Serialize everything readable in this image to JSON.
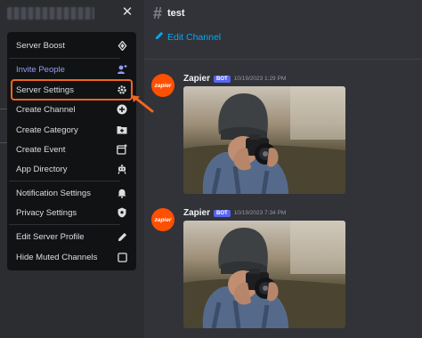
{
  "window": {
    "close_icon": "close-icon",
    "server_name_redacted": true
  },
  "channel": {
    "name": "test",
    "hash_icon": "hash-icon",
    "edit_label": "Edit Channel",
    "edit_icon": "pencil-icon"
  },
  "menu": {
    "items": [
      {
        "label": "Server Boost",
        "icon": "boost-icon"
      },
      {
        "label": "Invite People",
        "icon": "add-user-icon",
        "accent": true
      },
      {
        "label": "Server Settings",
        "icon": "gear-icon",
        "highlighted": true
      },
      {
        "label": "Create Channel",
        "icon": "plus-circle-icon"
      },
      {
        "label": "Create Category",
        "icon": "folder-plus-icon"
      },
      {
        "label": "Create Event",
        "icon": "calendar-plus-icon"
      },
      {
        "label": "App Directory",
        "icon": "robot-icon"
      },
      {
        "label": "Notification Settings",
        "icon": "bell-icon"
      },
      {
        "label": "Privacy Settings",
        "icon": "shield-icon"
      },
      {
        "label": "Edit Server Profile",
        "icon": "pencil-icon"
      },
      {
        "label": "Hide Muted Channels",
        "icon": "checkbox-icon"
      }
    ]
  },
  "messages": [
    {
      "author": "Zapier",
      "badge": "BOT",
      "timestamp": "10/19/2023 1:29 PM",
      "avatar_text": "zapier",
      "attachment": "photo-of-person-with-camera"
    },
    {
      "author": "Zapier",
      "badge": "BOT",
      "timestamp": "10/19/2023 7:34 PM",
      "avatar_text": "zapier",
      "attachment": "photo-of-person-with-camera"
    }
  ],
  "colors": {
    "accent_highlight": "#f26522",
    "invite_accent": "#949cf7",
    "link_blue": "#00a8fc",
    "bot_badge": "#5865f2",
    "zapier_orange": "#ff4f00"
  }
}
